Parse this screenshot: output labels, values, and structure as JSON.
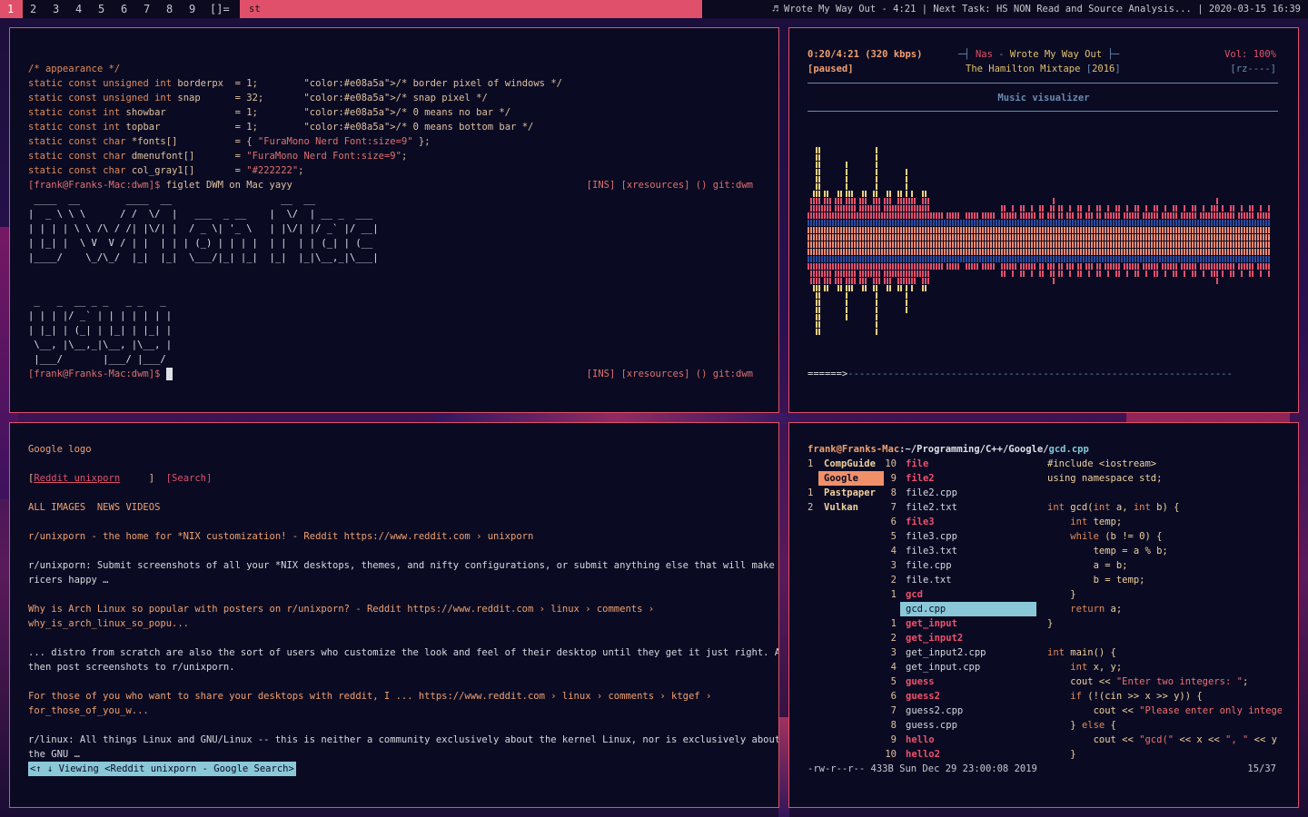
{
  "topbar": {
    "tags": [
      "1",
      "2",
      "3",
      "4",
      "5",
      "6",
      "7",
      "8",
      "9"
    ],
    "active_tag": "1",
    "layout": "[]=",
    "window_title": "st",
    "status": "♬ Wrote My Way Out - 4:21 | Next Task: HS NON Read and Source Analysis... | 2020-03-15 16:39"
  },
  "terminal": {
    "code": [
      "/* appearance */",
      "static const unsigned int borderpx  = 1;        /* border pixel of windows */",
      "static const unsigned int snap      = 32;       /* snap pixel */",
      "static const int showbar            = 1;        /* 0 means no bar */",
      "static const int topbar             = 1;        /* 0 means bottom bar */",
      "static const char *fonts[]          = { \"FuraMono Nerd Font:size=9\" };",
      "static const char dmenufont[]       = \"FuraMono Nerd Font:size=9\";",
      "static const char col_gray1[]       = \"#222222\";"
    ],
    "prompt1": "[frank@Franks-Mac:dwm]$ figlet DWM on Mac yayy",
    "prompt2": "[frank@Franks-Mac:dwm]$ ",
    "right_status": "[INS] [xresources] () git:dwm",
    "figlet": [
      " ____  __        ____  __                   __  __",
      "|  _ \\ \\ \\      / /  \\/  |   ___  _ __    |  \\/  | __ _  ___",
      "| | | | \\ \\ /\\ / /| |\\/| |  / _ \\| '_ \\   | |\\/| |/ _` |/ __|",
      "| |_| |  \\ V  V / | |  | | | (_) | | | |  | |  | | (_| | (__",
      "|____/    \\_/\\_/  |_|  |_|  \\___/|_| |_|  |_|  |_|\\__,_|\\___|",
      "",
      "",
      " _   _  __ _ _   _ _   _",
      "| | | |/ _` | | | | | | |",
      "| |_| | (_| | |_| | |_| |",
      " \\__, |\\__,_|\\__, |\\__, |",
      " |___/       |___/ |___/"
    ]
  },
  "music": {
    "time": "0:20/4:21 (320 kbps)",
    "state": "[paused]",
    "artist": "Nas",
    "song": "Wrote My Way Out",
    "album": "The Hamilton Mixtape",
    "year": "2016",
    "volume": "Vol: 100%",
    "flags": "[rz----]",
    "visualizer_title": "Music visualizer",
    "progress": "======>",
    "progress_fraction": 0.077
  },
  "browser": {
    "logo": "Google logo",
    "search_value": "Reddit unixporn",
    "search_button": "[Search]",
    "nav": "ALL IMAGES  NEWS VIDEOS",
    "results": [
      {
        "title": "r/unixporn - the home for *NIX customization! - Reddit https://www.reddit.com › unixporn",
        "lines": [],
        "title_color": "peach"
      },
      {
        "title": "r/unixporn: Submit screenshots of all your *NIX desktops, themes, and nifty configurations, or submit anything else that will make",
        "lines": [
          "ricers happy …"
        ],
        "title_color": "normal"
      },
      {
        "title": "Why is Arch Linux so popular with posters on r/unixporn? - Reddit https://www.reddit.com › linux › comments ›",
        "lines": [
          "why_is_arch_linux_so_popu..."
        ],
        "title_color": "peach"
      },
      {
        "title": "... distro from scratch are also the sort of users who customize the look and feel of their desktop until they get it just right. And",
        "lines": [
          "then post screenshots to r/unixporn."
        ],
        "title_color": "normal"
      },
      {
        "title": "For those of you who want to share your desktops with reddit, I ... https://www.reddit.com › linux › comments › ktgef ›",
        "lines": [
          "for_those_of_you_w..."
        ],
        "title_color": "peach"
      },
      {
        "title": "r/linux: All things Linux and GNU/Linux -- this is neither a community exclusively about the kernel Linux, nor is exclusively about",
        "lines": [
          "the GNU …"
        ],
        "title_color": "normal"
      }
    ],
    "status": "<↑ ↓ Viewing <Reddit unixporn - Google Search>"
  },
  "ranger": {
    "path_user": "frank@Franks-Mac",
    "path_dir": ":~/Programming/C++/Google/",
    "path_file": "gcd.cpp",
    "parent": [
      {
        "n": "1",
        "name": "CompGuide"
      },
      {
        "n": "",
        "name": "Google"
      },
      {
        "n": "1",
        "name": "Pastpaper"
      },
      {
        "n": "2",
        "name": "Vulkan"
      }
    ],
    "files": [
      {
        "n": "10",
        "name": "file",
        "bold": true
      },
      {
        "n": "9",
        "name": "file2",
        "bold": true
      },
      {
        "n": "8",
        "name": "file2.cpp",
        "bold": false
      },
      {
        "n": "7",
        "name": "file2.txt",
        "bold": false
      },
      {
        "n": "6",
        "name": "file3",
        "bold": true
      },
      {
        "n": "5",
        "name": "file3.cpp",
        "bold": false
      },
      {
        "n": "4",
        "name": "file3.txt",
        "bold": false
      },
      {
        "n": "3",
        "name": "file.cpp",
        "bold": false
      },
      {
        "n": "2",
        "name": "file.txt",
        "bold": false
      },
      {
        "n": "1",
        "name": "gcd",
        "bold": true
      },
      {
        "n": "",
        "name": "gcd.cpp",
        "bold": false
      },
      {
        "n": "1",
        "name": "get_input",
        "bold": true
      },
      {
        "n": "2",
        "name": "get_input2",
        "bold": true
      },
      {
        "n": "3",
        "name": "get_input2.cpp",
        "bold": false
      },
      {
        "n": "4",
        "name": "get_input.cpp",
        "bold": false
      },
      {
        "n": "5",
        "name": "guess",
        "bold": true
      },
      {
        "n": "6",
        "name": "guess2",
        "bold": true
      },
      {
        "n": "7",
        "name": "guess2.cpp",
        "bold": false
      },
      {
        "n": "8",
        "name": "guess.cpp",
        "bold": false
      },
      {
        "n": "9",
        "name": "hello",
        "bold": true
      },
      {
        "n": "10",
        "name": "hello2",
        "bold": true
      }
    ],
    "preview": [
      "#include <iostream>",
      "using namespace std;",
      "",
      "int gcd(int a, int b) {",
      "    int temp;",
      "    while (b != 0) {",
      "        temp = a % b;",
      "        a = b;",
      "        b = temp;",
      "    }",
      "    return a;",
      "}",
      "",
      "int main() {",
      "    int x, y;",
      "    cout << \"Enter two integers: \";",
      "    if (!(cin >> x >> y)) {",
      "        cout << \"Please enter only integer",
      "    } else {",
      "        cout << \"gcd(\" << x << \", \" << y <",
      "    }"
    ],
    "fileinfo": "-rw-r--r-- 433B Sun Dec 29 23:00:08 2019",
    "position": "15/37"
  }
}
